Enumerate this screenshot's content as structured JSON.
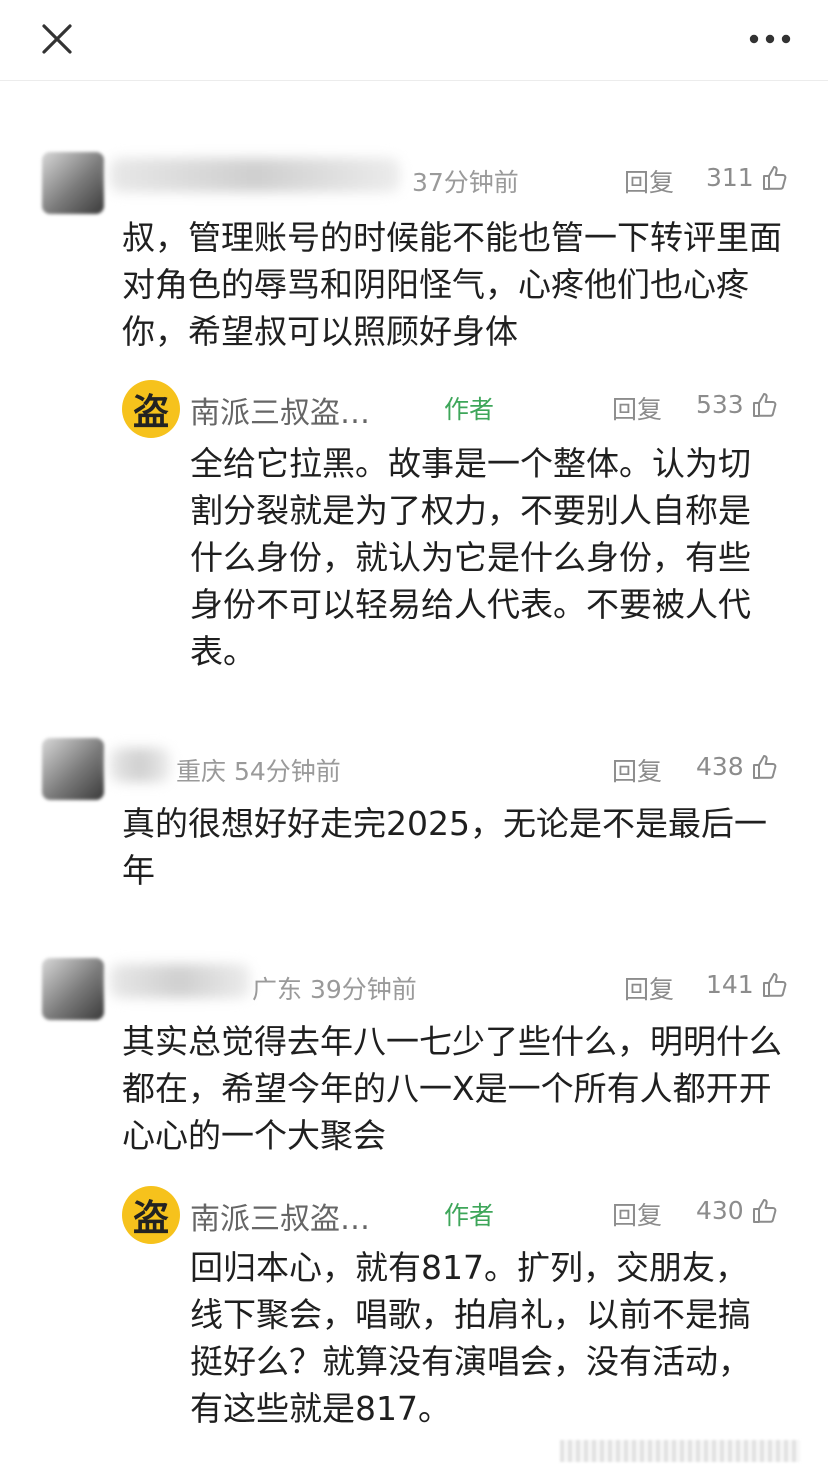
{
  "header": {
    "close_icon": "close-icon",
    "more_icon": "more-icon"
  },
  "comments": [
    {
      "meta": "37分钟前",
      "reply": "回复",
      "likes": "311",
      "text": "叔，管理账号的时候能不能也管一下转评里面对角色的辱骂和阴阳怪气，心疼他们也心疼你，希望叔可以照顾好身体",
      "author_reply": {
        "name": "南派三叔盗…",
        "tag": "作者",
        "reply": "回复",
        "likes": "533",
        "avatar_char": "盗",
        "text": "全给它拉黑。故事是一个整体。认为切割分裂就是为了权力，不要别人自称是什么身份，就认为它是什么身份，有些身份不可以轻易给人代表。不要被人代表。"
      }
    },
    {
      "meta": "重庆 54分钟前",
      "reply": "回复",
      "likes": "438",
      "text": "真的很想好好走完2025，无论是不是最后一年"
    },
    {
      "meta": "广东 39分钟前",
      "reply": "回复",
      "likes": "141",
      "text": "其实总觉得去年八一七少了些什么，明明什么都在，希望今年的八一X是一个所有人都开开心心的一个大聚会",
      "author_reply": {
        "name": "南派三叔盗…",
        "tag": "作者",
        "reply": "回复",
        "likes": "430",
        "avatar_char": "盗",
        "text": "回归本心，就有817。扩列，交朋友，线下聚会，唱歌，拍肩礼，以前不是搞挺好么？就算没有演唱会，没有活动，有这些就是817。"
      }
    }
  ],
  "colors": {
    "author_tag": "#3ea65a",
    "meta": "#9a9a9a",
    "avatar_bg": "#f6c21c"
  }
}
